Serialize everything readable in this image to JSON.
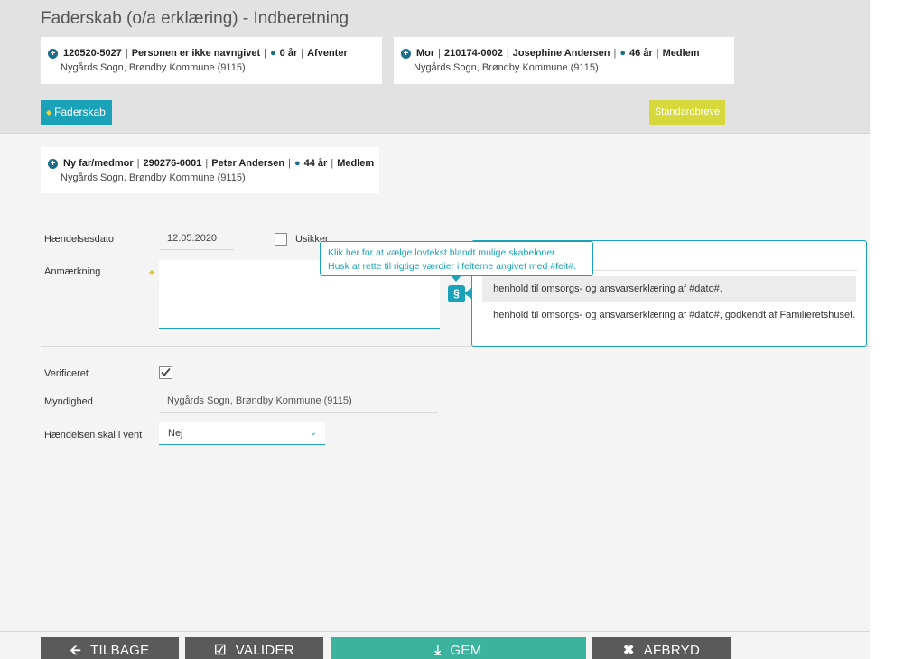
{
  "page": {
    "title": "Faderskab (o/a erklæring) - Indberetning"
  },
  "child_card": {
    "id": "120520-5027",
    "name": "Personen er ikke navngivet",
    "age": "0 år",
    "status": "Afventer",
    "location": "Nygårds Sogn, Brøndby Kommune (9115)"
  },
  "mother_card": {
    "role": "Mor",
    "id": "210174-0002",
    "name": "Josephine Andersen",
    "age": "46 år",
    "status": "Medlem",
    "location": "Nygårds Sogn, Brøndby Kommune (9115)"
  },
  "father_card": {
    "role": "Ny far/medmor",
    "id": "290276-0001",
    "name": "Peter Andersen",
    "age": "44 år",
    "status": "Medlem",
    "location": "Nygårds Sogn, Brøndby Kommune (9115)"
  },
  "tags": {
    "faderskab": "Faderskab",
    "standardbreve": "Standardbreve"
  },
  "form": {
    "haendelsesdato_label": "Hændelsesdato",
    "haendelsesdato_value": "12.05.2020",
    "usikker_label": "Usikker",
    "anmaerkning_label": "Anmærkning",
    "anmaerkning_value": "",
    "verificeret_label": "Verificeret",
    "myndighed_label": "Myndighed",
    "myndighed_value": "Nygårds Sogn, Brøndby Kommune (9115)",
    "vent_label": "Hændelsen skal i vent",
    "vent_value": "Nej"
  },
  "tooltip": {
    "line1": "Klik her for at vælge lovtekst blandt mulige skabeloner.",
    "line2": "Husk at rette til rigtige værdier i felterne angivet med #felt#."
  },
  "templates": [
    "I henhold til omsorgs- og ansvarserklæring af #dato#.",
    "I henhold til omsorgs- og ansvarserklæring af #dato#, godkendt af Familieretshuset."
  ],
  "footer": {
    "back": "TILBAGE",
    "valider": "VALIDER",
    "gem": "GEM",
    "afbryd": "AFBRYD"
  },
  "colors": {
    "accent": "#1aa3b8",
    "save": "#3bb39f",
    "standard": "#d7d83c",
    "dark_button": "#5a5a5a"
  }
}
